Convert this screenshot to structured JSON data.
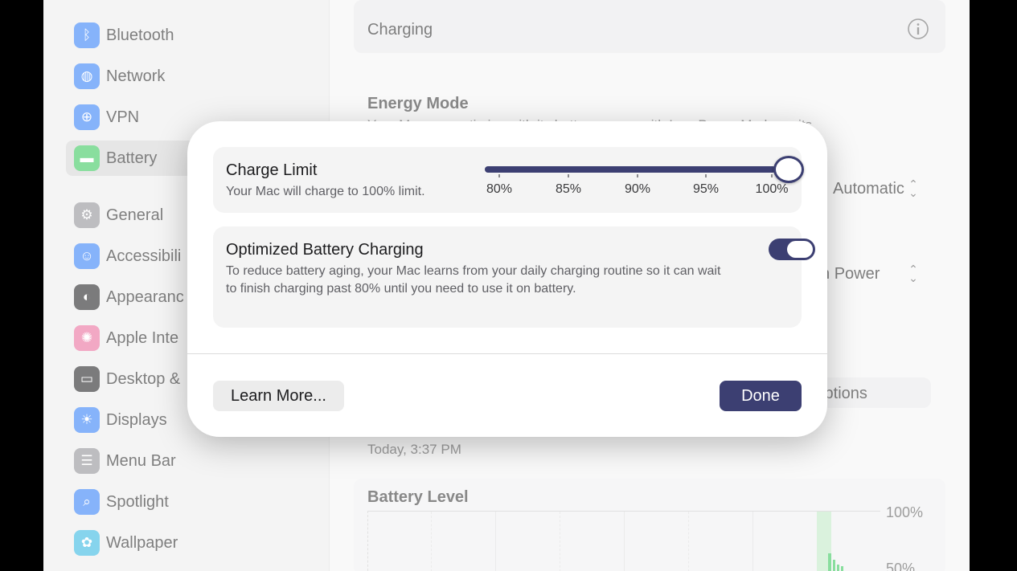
{
  "sidebar": {
    "items": [
      {
        "label": "Bluetooth",
        "icon": "bluetooth-icon",
        "color": "#2f7cf6"
      },
      {
        "label": "Network",
        "icon": "globe-icon",
        "color": "#2f7cf6"
      },
      {
        "label": "VPN",
        "icon": "vpn-icon",
        "color": "#2f7cf6"
      },
      {
        "label": "Battery",
        "icon": "battery-icon",
        "color": "#34c759"
      },
      {
        "label": "General",
        "icon": "gear-icon",
        "color": "#8e8e93"
      },
      {
        "label": "Accessibili",
        "icon": "accessibility-icon",
        "color": "#2f7cf6"
      },
      {
        "label": "Appearanc",
        "icon": "appearance-icon",
        "color": "#1c1c1e"
      },
      {
        "label": "Apple Inte",
        "icon": "apple-intelligence-icon",
        "color": "#e86a9a"
      },
      {
        "label": "Desktop &",
        "icon": "desktop-icon",
        "color": "#1c1c1e"
      },
      {
        "label": "Displays",
        "icon": "sun-icon",
        "color": "#2f7cf6"
      },
      {
        "label": "Menu Bar",
        "icon": "menubar-icon",
        "color": "#8e8e93"
      },
      {
        "label": "Spotlight",
        "icon": "search-icon",
        "color": "#2f7cf6"
      },
      {
        "label": "Wallpaper",
        "icon": "flower-icon",
        "color": "#2fb6e0"
      }
    ]
  },
  "main": {
    "charging_label": "Charging",
    "energy_mode_heading": "Energy Mode",
    "energy_mode_desc": "Your Mac can optimize with its battery power with Low Power Mode, or its",
    "automatic_value": "Automatic",
    "power_value": "High Power",
    "options_label": "Options",
    "last_charged_time": "Today, 3:37 PM",
    "battery_level_heading": "Battery Level",
    "axis_100": "100%",
    "axis_50": "50%"
  },
  "dialog": {
    "charge_limit": {
      "title": "Charge Limit",
      "subtitle": "Your Mac will charge to 100% limit.",
      "slider_value_percent": 100,
      "ticks": [
        "80%",
        "85%",
        "90%",
        "95%",
        "100%"
      ]
    },
    "optimized": {
      "title": "Optimized Battery Charging",
      "description": "To reduce battery aging, your Mac learns from your daily charging routine so it can wait to finish charging past 80% until you need to use it on battery.",
      "enabled": true
    },
    "learn_more_label": "Learn More...",
    "done_label": "Done"
  },
  "colors": {
    "accent": "#3c3f72",
    "battery_green": "#34c759"
  }
}
